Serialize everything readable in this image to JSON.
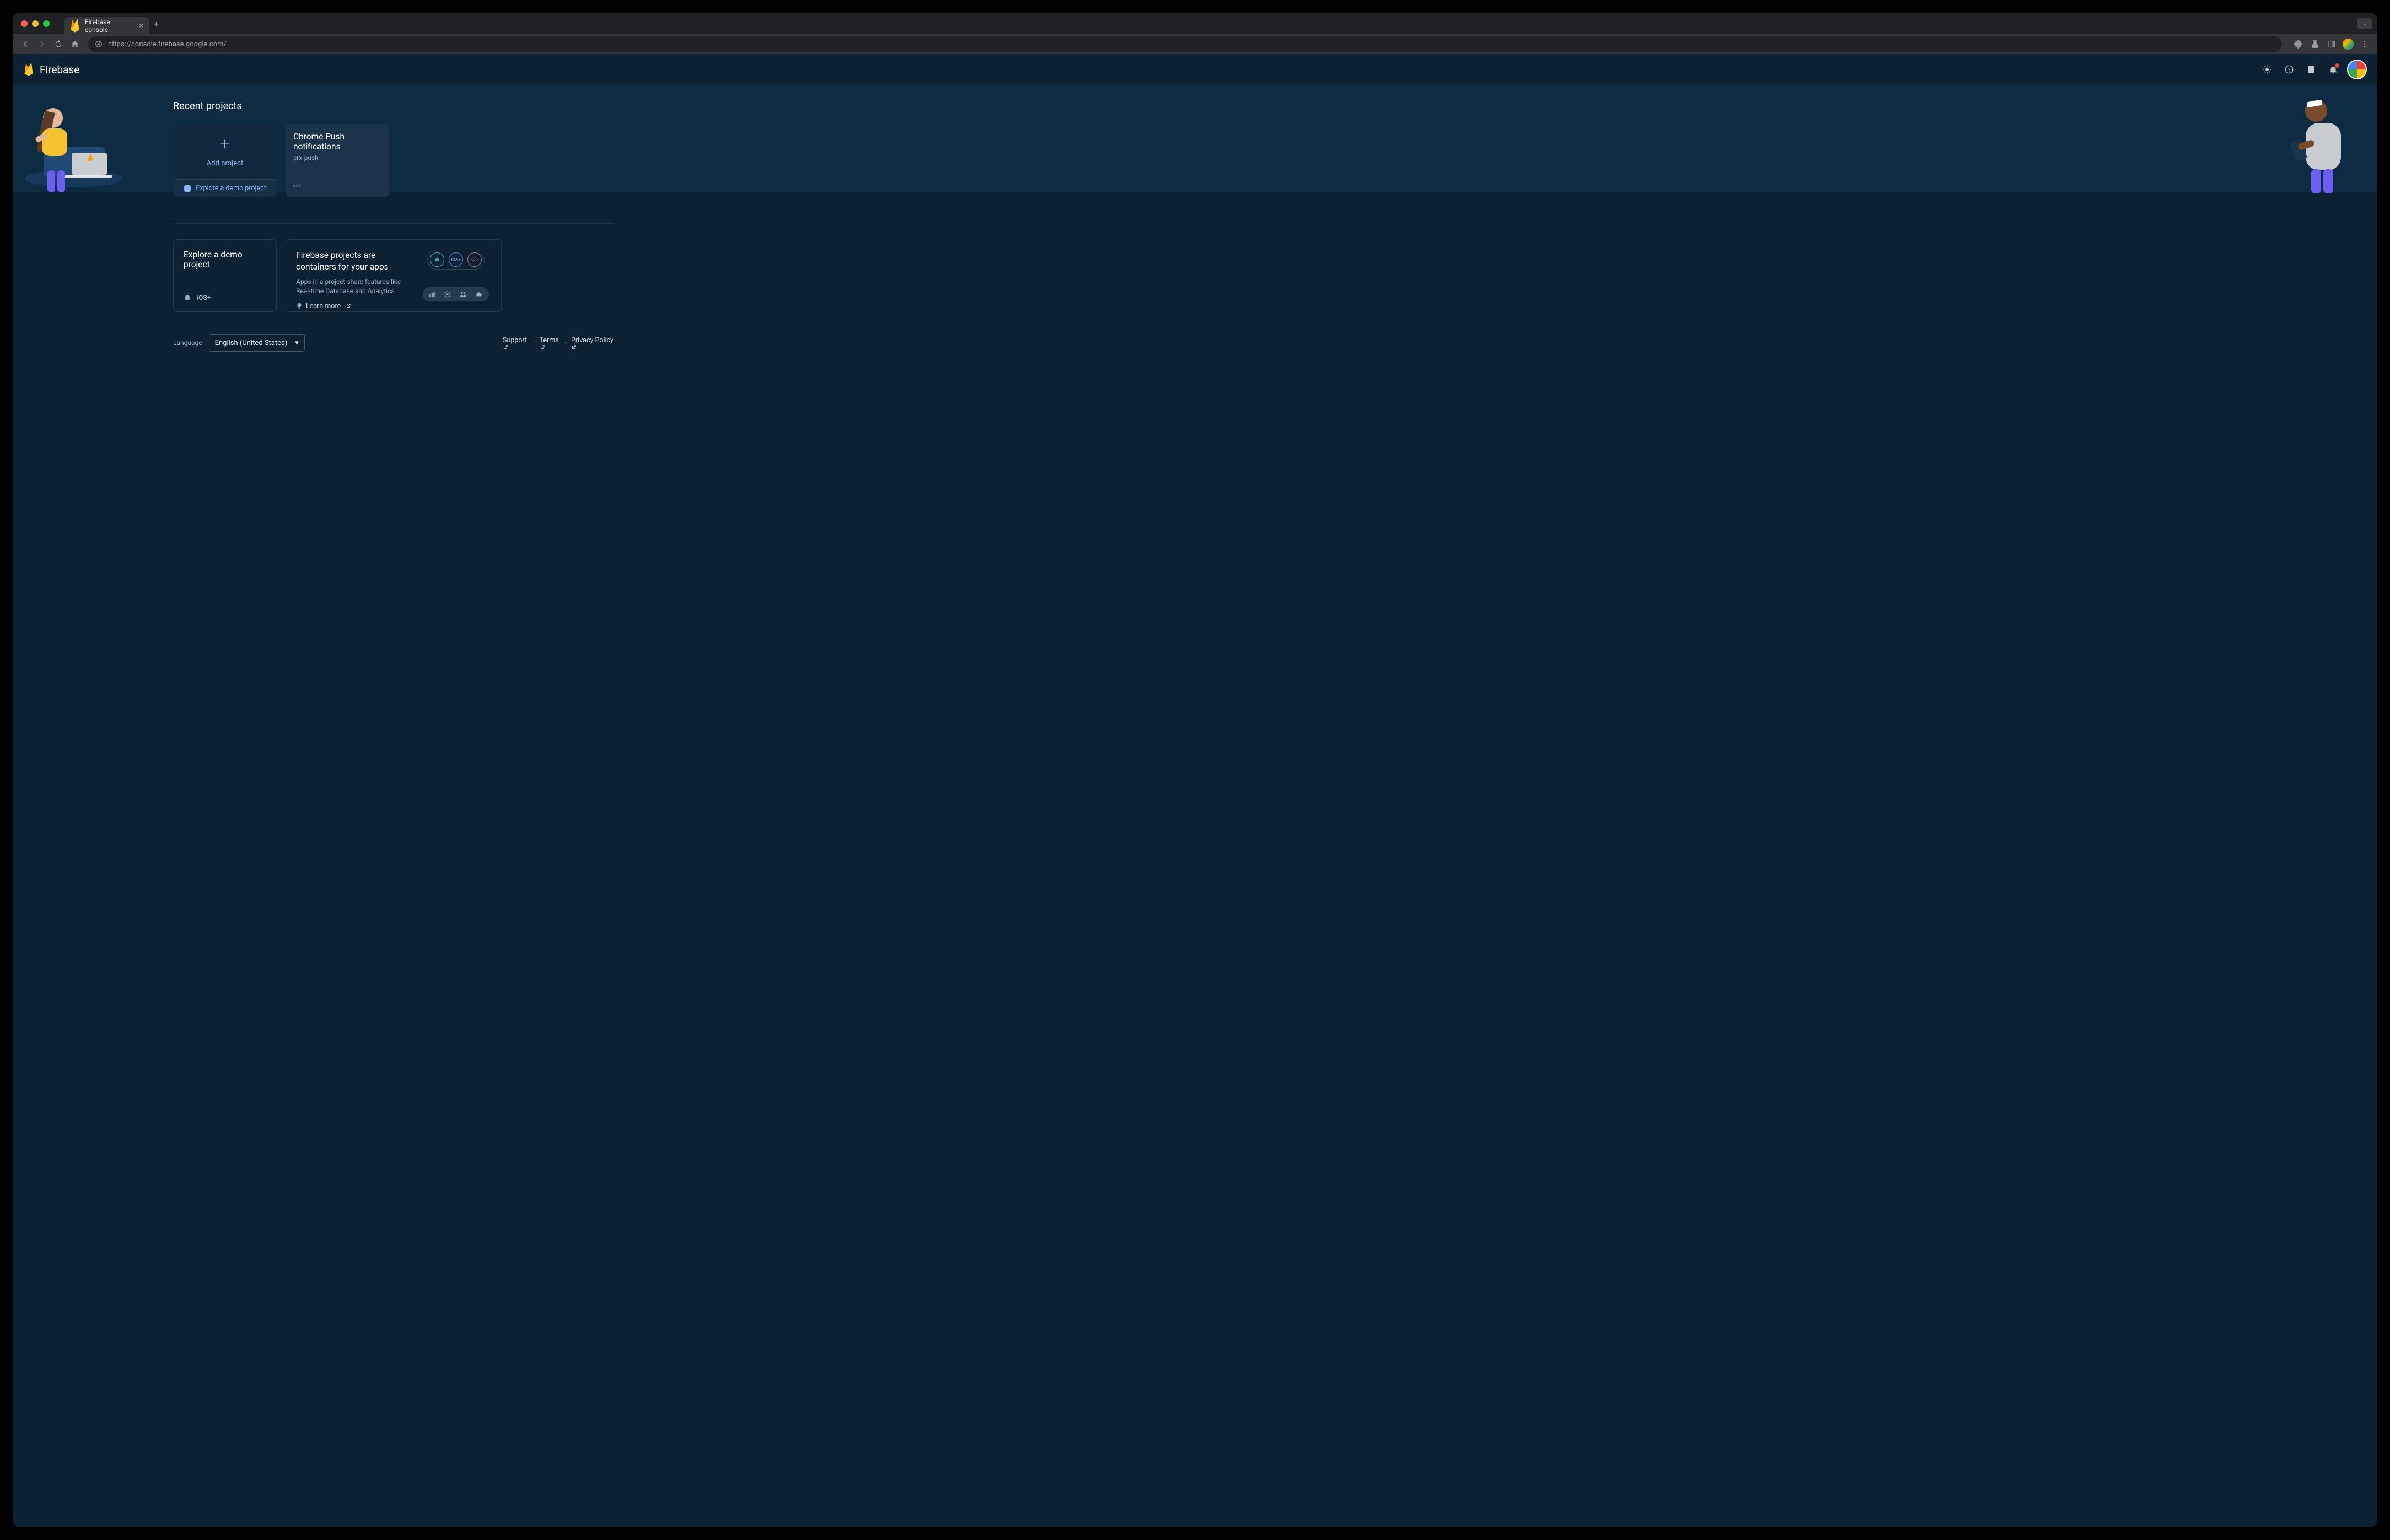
{
  "window": {
    "tab_title": "Firebase console",
    "tabs_caret": "⌄"
  },
  "toolbar": {
    "url_secure_icon": "🔒",
    "url_display_host": "https://console.firebase.google.com",
    "url_display_path": "/"
  },
  "header": {
    "brand": "Firebase"
  },
  "main": {
    "section_title": "Recent projects",
    "add_project_label": "Add project",
    "explore_demo_label": "Explore a demo project",
    "projects": [
      {
        "title": "Chrome Push notifications",
        "id": "crx-push",
        "platform_icon": "web"
      }
    ],
    "demo_card": {
      "title": "Explore a demo project"
    },
    "info_card": {
      "title": "Firebase projects are containers for your apps",
      "desc": "Apps in a project share features like Real-time Database and Analytics",
      "learn_more": "Learn more"
    }
  },
  "footer": {
    "language_label": "Language",
    "language_value": "English (United States)",
    "links": {
      "support": "Support",
      "terms": "Terms",
      "privacy": "Privacy Policy"
    }
  }
}
